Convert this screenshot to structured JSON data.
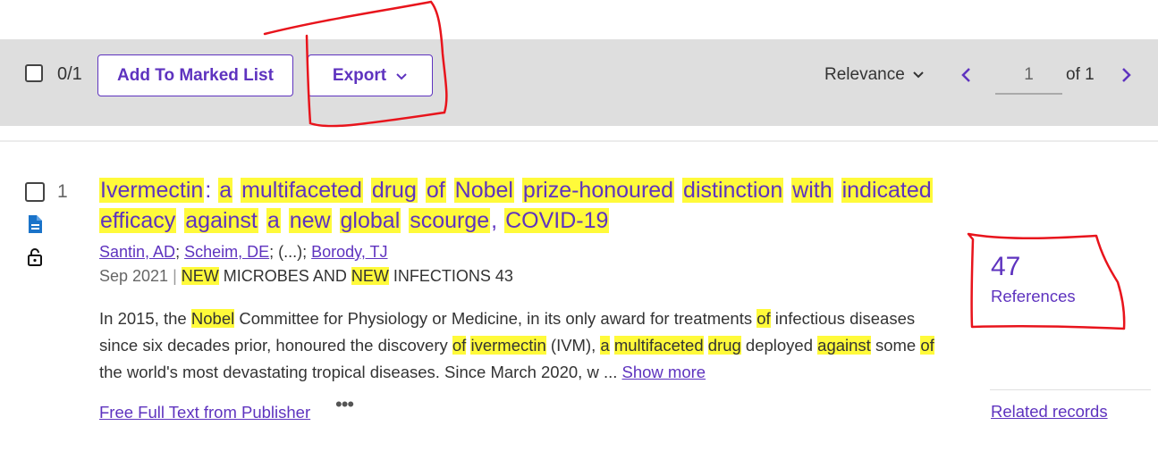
{
  "toolbar": {
    "selected_count": "0/1",
    "add_to_marked_list": "Add To Marked List",
    "export": "Export",
    "sort": "Relevance",
    "page_current": "1",
    "page_of": "of 1"
  },
  "record": {
    "number": "1",
    "title_segments": [
      {
        "t": "Ivermectin",
        "hl": true
      },
      {
        "t": ": ",
        "hl": false
      },
      {
        "t": "a",
        "hl": true
      },
      {
        "t": " ",
        "hl": false
      },
      {
        "t": "multifaceted",
        "hl": true
      },
      {
        "t": " ",
        "hl": false
      },
      {
        "t": "drug",
        "hl": true
      },
      {
        "t": " ",
        "hl": false
      },
      {
        "t": "of",
        "hl": true
      },
      {
        "t": " ",
        "hl": false
      },
      {
        "t": "Nobel",
        "hl": true
      },
      {
        "t": " ",
        "hl": false
      },
      {
        "t": "prize-honoured",
        "hl": true
      },
      {
        "t": " ",
        "hl": false
      },
      {
        "t": "distinction",
        "hl": true
      },
      {
        "t": " ",
        "hl": false
      },
      {
        "t": "with",
        "hl": true
      },
      {
        "t": " ",
        "hl": false
      },
      {
        "t": "indicated",
        "hl": true
      },
      {
        "t": " ",
        "hl": false
      },
      {
        "t": "efficacy",
        "hl": true
      },
      {
        "t": " ",
        "hl": false
      },
      {
        "t": "against",
        "hl": true
      },
      {
        "t": " ",
        "hl": false
      },
      {
        "t": "a",
        "hl": true
      },
      {
        "t": " ",
        "hl": false
      },
      {
        "t": "new",
        "hl": true
      },
      {
        "t": " ",
        "hl": false
      },
      {
        "t": "global",
        "hl": true
      },
      {
        "t": " ",
        "hl": false
      },
      {
        "t": "scourge",
        "hl": true
      },
      {
        "t": ", ",
        "hl": false
      },
      {
        "t": "COVID-19",
        "hl": true
      }
    ],
    "authors": {
      "a1": "Santin, AD",
      "a2": "Scheim, DE",
      "ellipsis": "(...)",
      "a3": "Borody, TJ"
    },
    "date": "Sep 2021",
    "journal_segments": [
      {
        "t": "NEW",
        "hl": true
      },
      {
        "t": " MICROBES AND ",
        "hl": false
      },
      {
        "t": "NEW",
        "hl": true
      },
      {
        "t": " INFECTIONS",
        "hl": false
      }
    ],
    "volume": "43",
    "abstract_segments": [
      {
        "t": "In 2015, the ",
        "hl": false
      },
      {
        "t": "Nobel",
        "hl": true
      },
      {
        "t": " Committee for Physiology or Medicine, in its only award for treatments ",
        "hl": false
      },
      {
        "t": "of",
        "hl": true
      },
      {
        "t": " infectious diseases since six decades prior, honoured the discovery ",
        "hl": false
      },
      {
        "t": "of",
        "hl": true
      },
      {
        "t": " ",
        "hl": false
      },
      {
        "t": "ivermectin",
        "hl": true
      },
      {
        "t": " (IVM), ",
        "hl": false
      },
      {
        "t": "a",
        "hl": true
      },
      {
        "t": " ",
        "hl": false
      },
      {
        "t": "multifaceted",
        "hl": true
      },
      {
        "t": " ",
        "hl": false
      },
      {
        "t": "drug",
        "hl": true
      },
      {
        "t": " deployed ",
        "hl": false
      },
      {
        "t": "against",
        "hl": true
      },
      {
        "t": " some ",
        "hl": false
      },
      {
        "t": "of",
        "hl": true
      },
      {
        "t": " the world's most devastating tropical diseases. Since March 2020, w ... ",
        "hl": false
      }
    ],
    "show_more": "Show more",
    "full_text": "Free Full Text from Publisher",
    "more_actions": "•••",
    "references_count": "47",
    "references_label": "References",
    "related_records": "Related records"
  },
  "colors": {
    "accent": "#5e33bf",
    "highlight": "#fffa3a",
    "toolbar_bg": "#dedede",
    "annotation_red": "#e8141c"
  },
  "icons": [
    "checkbox-icon",
    "chevron-down-icon",
    "chevron-left-icon",
    "chevron-right-icon",
    "document-icon",
    "open-lock-icon"
  ]
}
